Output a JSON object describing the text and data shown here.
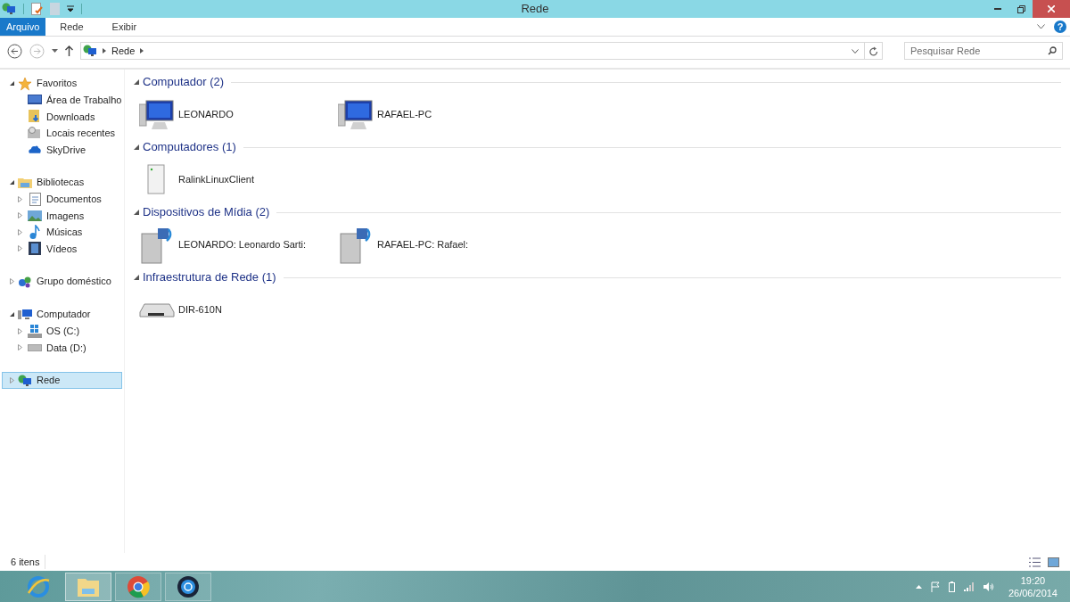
{
  "window": {
    "title": "Rede"
  },
  "ribbon": {
    "tabs": [
      {
        "label": "Arquivo",
        "selected": true
      },
      {
        "label": "Rede",
        "selected": false
      },
      {
        "label": "Exibir",
        "selected": false
      }
    ],
    "help": "?"
  },
  "address": {
    "crumbs": [
      "Rede"
    ]
  },
  "search": {
    "placeholder": "Pesquisar Rede"
  },
  "sidebar": {
    "groups": [
      {
        "label": "Favoritos",
        "expanded": true,
        "selected": false,
        "children": [
          {
            "label": "Área de Trabalho",
            "kind": "leaf"
          },
          {
            "label": "Downloads",
            "kind": "leaf"
          },
          {
            "label": "Locais recentes",
            "kind": "leaf"
          },
          {
            "label": "SkyDrive",
            "kind": "leaf"
          }
        ]
      },
      {
        "label": "Bibliotecas",
        "expanded": true,
        "selected": false,
        "children": [
          {
            "label": "Documentos",
            "kind": "branch"
          },
          {
            "label": "Imagens",
            "kind": "branch"
          },
          {
            "label": "Músicas",
            "kind": "branch"
          },
          {
            "label": "Vídeos",
            "kind": "branch"
          }
        ]
      },
      {
        "label": "Grupo doméstico",
        "expanded": false,
        "selected": false
      },
      {
        "label": "Computador",
        "expanded": true,
        "selected": false,
        "children": [
          {
            "label": "OS (C:)",
            "kind": "branch"
          },
          {
            "label": "Data (D:)",
            "kind": "branch"
          }
        ]
      },
      {
        "label": "Rede",
        "expanded": false,
        "selected": true
      }
    ]
  },
  "content": {
    "groups": [
      {
        "title": "Computador (2)",
        "items": [
          {
            "label": "LEONARDO"
          },
          {
            "label": "RAFAEL-PC"
          }
        ]
      },
      {
        "title": "Computadores (1)",
        "items": [
          {
            "label": "RalinkLinuxClient"
          }
        ]
      },
      {
        "title": "Dispositivos de Mídia (2)",
        "items": [
          {
            "label": "LEONARDO: Leonardo Sarti:"
          },
          {
            "label": "RAFAEL-PC: Rafael:"
          }
        ]
      },
      {
        "title": "Infraestrutura de Rede (1)",
        "items": [
          {
            "label": "DIR-610N"
          }
        ]
      }
    ]
  },
  "status_bar": {
    "count": "6 itens"
  },
  "taskbar": {
    "apps": [
      {
        "selected": false
      },
      {
        "selected": true
      },
      {
        "selected": false
      },
      {
        "selected": false
      }
    ],
    "clock": {
      "time": "19:20",
      "date": "26/06/2014"
    }
  }
}
